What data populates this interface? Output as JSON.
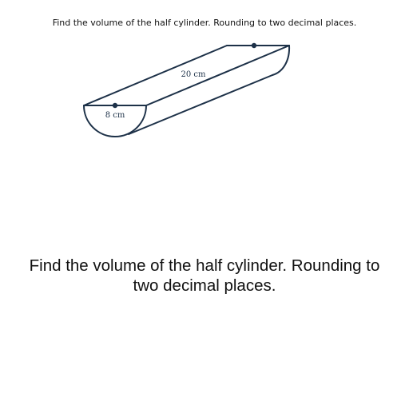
{
  "header": {
    "caption": "Find the volume of the half cylinder. Rounding to two decimal places."
  },
  "figure": {
    "length_label": "20 cm",
    "diameter_label": "8 cm",
    "line_color": "#1d3148"
  },
  "question": {
    "text": "Find the volume of the half cylinder. Rounding to two decimal places."
  }
}
